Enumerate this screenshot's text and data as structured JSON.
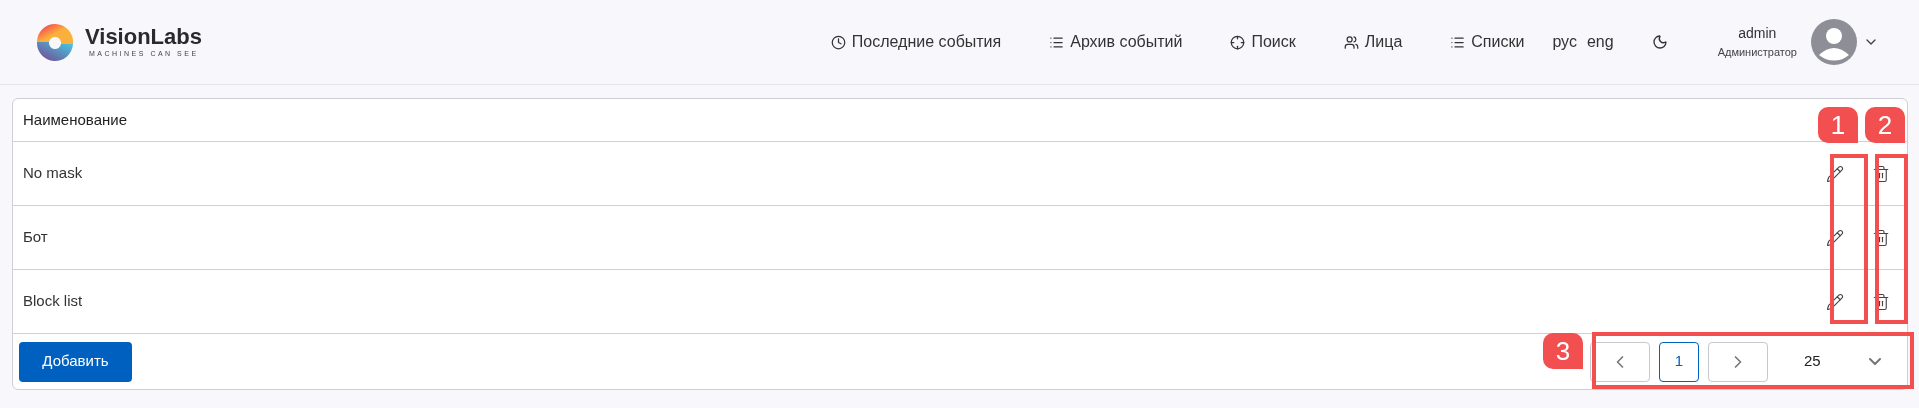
{
  "header": {
    "logo": {
      "name": "VisionLabs",
      "tagline": "MACHINES CAN SEE"
    },
    "nav": [
      {
        "label": "Последние события",
        "kind": "clock"
      },
      {
        "label": "Архив событий",
        "kind": "list"
      },
      {
        "label": "Поиск",
        "kind": "target"
      },
      {
        "label": "Лица",
        "kind": "users"
      },
      {
        "label": "Списки",
        "kind": "list"
      }
    ],
    "languages": [
      "рус",
      "eng"
    ],
    "user": {
      "name": "admin",
      "role": "Администратор"
    }
  },
  "table": {
    "columns": [
      "Наименование"
    ],
    "rows": [
      {
        "name": "No mask"
      },
      {
        "name": "Бот"
      },
      {
        "name": "Block list"
      }
    ]
  },
  "add_button": "Добавить",
  "pagination": {
    "pages": [
      {
        "label": "1",
        "selected": true
      }
    ],
    "page_size": "25"
  },
  "annotations": [
    {
      "label": "1",
      "kind": "edit"
    },
    {
      "label": "2",
      "kind": "delete"
    },
    {
      "label": "3",
      "kind": "pagination"
    }
  ]
}
